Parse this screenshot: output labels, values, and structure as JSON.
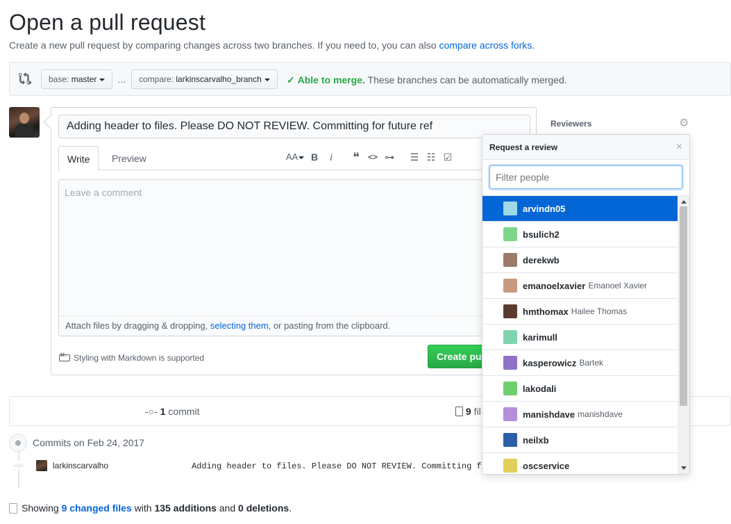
{
  "header": {
    "title": "Open a pull request",
    "subtitle_prefix": "Create a new pull request by comparing changes across two branches. If you need to, you can also ",
    "subtitle_link": "compare across forks",
    "subtitle_suffix": "."
  },
  "range": {
    "base_prefix": "base: ",
    "base_value": "master",
    "ellipsis": "…",
    "compare_prefix": "compare: ",
    "compare_value": "larkinscarvalho_branch",
    "merge_status": "Able to merge.",
    "merge_detail": " These branches can be automatically merged."
  },
  "form": {
    "title_value": "Adding header to files. Please DO NOT REVIEW. Committing for future ref",
    "tab_write": "Write",
    "tab_preview": "Preview",
    "comment_placeholder": "Leave a comment",
    "attach_prefix": "Attach files by dragging & dropping, ",
    "attach_link": "selecting them",
    "attach_suffix": ", or pasting from the clipboard.",
    "markdown_note": "Styling with Markdown is supported",
    "create_button": "Create pull request",
    "toolbar": {
      "heading": "AA",
      "bold": "B",
      "italic": "i",
      "quote": "❝",
      "code": "<>",
      "link": "⊶",
      "ul": "☰",
      "ol": "☷",
      "task": "☑"
    }
  },
  "sidebar": {
    "reviewers_label": "Reviewers"
  },
  "popover": {
    "title": "Request a review",
    "close": "×",
    "filter_placeholder": "Filter people",
    "people": [
      {
        "login": "arvindn05",
        "name": "",
        "color": "#9fd8e6",
        "selected": true
      },
      {
        "login": "bsulich2",
        "name": "",
        "color": "#7ed68c",
        "selected": false
      },
      {
        "login": "derekwb",
        "name": "",
        "color": "#9c7b68",
        "selected": false
      },
      {
        "login": "emanoelxavier",
        "name": "Emanoel Xavier",
        "color": "#c79a80",
        "selected": false
      },
      {
        "login": "hmthomax",
        "name": "Hailee Thomas",
        "color": "#5a3b2e",
        "selected": false
      },
      {
        "login": "karimull",
        "name": "",
        "color": "#7fd4b0",
        "selected": false
      },
      {
        "login": "kasperowicz",
        "name": "Bartek",
        "color": "#8e73c9",
        "selected": false
      },
      {
        "login": "lakodali",
        "name": "",
        "color": "#6fcf6f",
        "selected": false
      },
      {
        "login": "manishdave",
        "name": "manishdave",
        "color": "#b28fd6",
        "selected": false
      },
      {
        "login": "neilxb",
        "name": "",
        "color": "#2c5fa8",
        "selected": false
      },
      {
        "login": "oscservice",
        "name": "",
        "color": "#e0cf5a",
        "selected": false
      }
    ]
  },
  "summary": {
    "commits_count": "1",
    "commits_label": " commit",
    "files_count": "9",
    "files_label": " fil"
  },
  "commits": {
    "date_label": "Commits on Feb 24, 2017",
    "author": "larkinscarvalho",
    "message": "Adding header to files. Please DO NOT REVIEW. Committing for fut"
  },
  "footer": {
    "showing_prefix": "Showing ",
    "changed_files": "9 changed files",
    "with": " with ",
    "additions": "135 additions",
    "and": " and ",
    "deletions": "0 deletions",
    "period": "."
  }
}
